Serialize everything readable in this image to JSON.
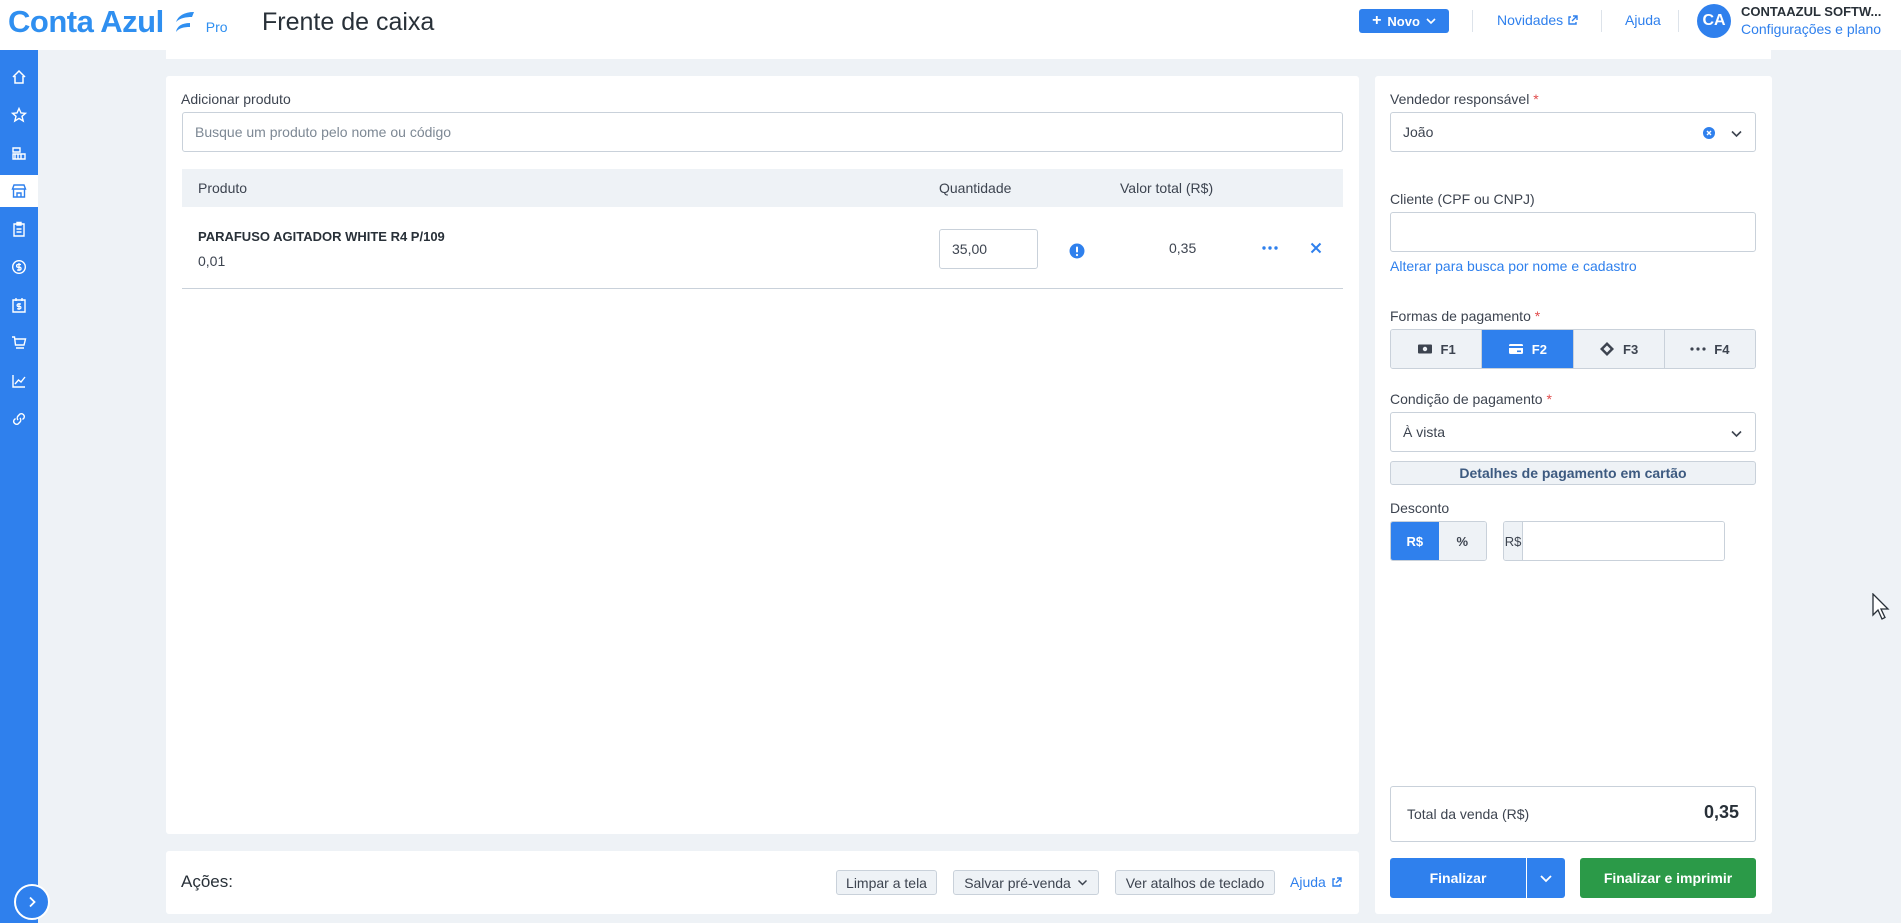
{
  "header": {
    "logo_text": "Conta Azul",
    "logo_badge": "Pro",
    "page_title": "Frente de caixa",
    "new_button": "Novo",
    "news_link": "Novidades",
    "help_link": "Ajuda",
    "avatar_initials": "CA",
    "company_name": "CONTAAZUL SOFTW...",
    "plan_link": "Configurações e plano"
  },
  "sidebar": {
    "items": [
      {
        "icon": "home-icon"
      },
      {
        "icon": "star-icon"
      },
      {
        "icon": "bank-icon"
      },
      {
        "icon": "store-icon",
        "active": true
      },
      {
        "icon": "clipboard-icon"
      },
      {
        "icon": "dollar-icon"
      },
      {
        "icon": "calendar-dollar-icon"
      },
      {
        "icon": "cart-icon"
      },
      {
        "icon": "chart-icon"
      },
      {
        "icon": "link-icon"
      }
    ]
  },
  "products": {
    "add_label": "Adicionar produto",
    "search_placeholder": "Busque um produto pelo nome ou código",
    "columns": {
      "product": "Produto",
      "quantity": "Quantidade",
      "total": "Valor total (R$)"
    },
    "rows": [
      {
        "name": "PARAFUSO AGITADOR WHITE R4 P/109",
        "unit_price": "0,01",
        "quantity": "35,00",
        "total": "0,35"
      }
    ]
  },
  "actions": {
    "label": "Ações:",
    "clear": "Limpar a tela",
    "save_presale": "Salvar pré-venda",
    "shortcuts": "Ver atalhos de teclado",
    "help": "Ajuda"
  },
  "sale": {
    "seller_label": "Vendedor responsável",
    "required_mark": "*",
    "seller_value": "João",
    "client_label": "Cliente (CPF ou CNPJ)",
    "client_value": "",
    "client_switch_link": "Alterar para busca por nome e cadastro",
    "payment_label": "Formas de pagamento",
    "payment_methods": [
      {
        "key": "F1",
        "icon": "cash-icon"
      },
      {
        "key": "F2",
        "icon": "card-icon",
        "active": true
      },
      {
        "key": "F3",
        "icon": "pix-icon"
      },
      {
        "key": "F4",
        "icon": "more-icon"
      }
    ],
    "condition_label": "Condição de pagamento",
    "condition_value": "À vista",
    "card_details": "Detalhes de pagamento em cartão",
    "discount_label": "Desconto",
    "discount_currency": "R$",
    "discount_percent": "%",
    "discount_prefix": "R$",
    "discount_value": "",
    "total_label": "Total da venda (R$)",
    "total_value": "0,35",
    "finalize": "Finalizar",
    "finalize_print": "Finalizar e imprimir"
  },
  "colors": {
    "accent": "#2f80ed",
    "success": "#2b9a48",
    "background": "#eef2f6"
  }
}
